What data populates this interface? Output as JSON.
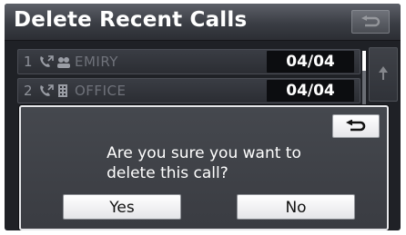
{
  "header": {
    "title": "Delete Recent Calls"
  },
  "call_list": [
    {
      "index": "1",
      "category_icon": "contacts-icon",
      "name": "EMIRY",
      "date": "04/04"
    },
    {
      "index": "2",
      "category_icon": "office-building-icon",
      "name": "OFFICE",
      "date": "04/04"
    }
  ],
  "dialog": {
    "message_line1": "Are you sure you want to",
    "message_line2": "delete this call?",
    "yes_label": "Yes",
    "no_label": "No",
    "back_icon": "return-arrow-icon"
  },
  "colors": {
    "background": "#1f2126",
    "dialog_border": "#e6e7ea",
    "date_field": "#0c0d10",
    "button_face": "#ffffff"
  }
}
